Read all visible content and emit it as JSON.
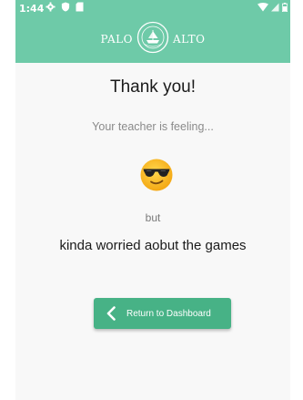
{
  "status_bar": {
    "time": "1:44"
  },
  "header": {
    "logo_left": "PALO",
    "logo_right": "ALTO",
    "brand_color": "#6ecaa8"
  },
  "main": {
    "title": "Thank you!",
    "subtitle": "Your teacher is feeling...",
    "mood_icon": "cool-sunglasses-face",
    "conjunction": "but",
    "message": "kinda worried aobut the games"
  },
  "actions": {
    "return_label": "Return to Dashboard",
    "return_icon": "chevron-left-icon",
    "button_color": "#47b286"
  }
}
